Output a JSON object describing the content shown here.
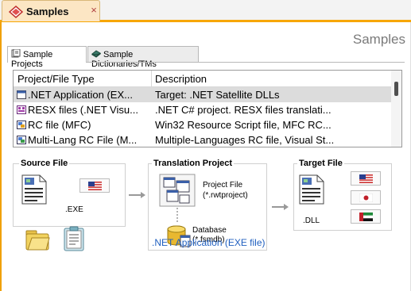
{
  "document_tab": {
    "title": "Samples",
    "close": "×"
  },
  "page": {
    "title": "Samples"
  },
  "tabs": [
    {
      "label": "Sample Projects"
    },
    {
      "label": "Sample Dictionaries/TMs"
    }
  ],
  "list": {
    "columns": [
      "Project/File Type",
      "Description"
    ],
    "rows": [
      {
        "type": ".NET Application (EX...",
        "description": "Target: .NET Satellite DLLs"
      },
      {
        "type": "RESX files (.NET Visu...",
        "description": ".NET C# project. RESX files translati..."
      },
      {
        "type": "RC file (MFC)",
        "description": "Win32 Resource Script file, MFC RC..."
      },
      {
        "type": "Multi-Lang RC File (M...",
        "description": "Multiple-Languages RC file, Visual St..."
      }
    ]
  },
  "diagram": {
    "source": {
      "title": "Source File",
      "ext": ".EXE"
    },
    "translation": {
      "title": "Translation Project",
      "project_label": "Project File",
      "project_ext": "(*.rwtproject)",
      "db_label": "Database",
      "db_ext": "(*.fsmdb)"
    },
    "target": {
      "title": "Target File",
      "ext": ".DLL"
    },
    "link": ".NET Application (EXE file)"
  },
  "colors": {
    "accent": "#f7a600",
    "link": "#1f5fbf"
  }
}
